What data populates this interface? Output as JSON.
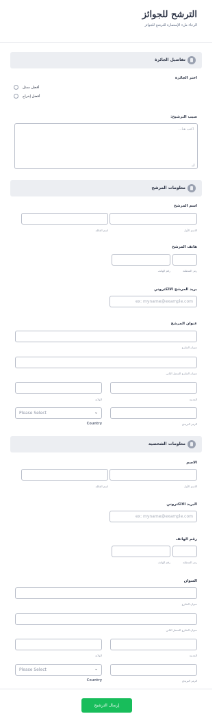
{
  "header": {
    "title": "الترشح للجوائز",
    "subtitle": "الرجاء ملء الإستمارة للترشح للجوائز"
  },
  "sections": {
    "award": "تفاصيل الجائزة",
    "nominee": "معلومات المرشح",
    "personal": "معلومات الشخصية"
  },
  "award": {
    "choose_label": "اختر الجائزة",
    "options": [
      "أفضل ممثل",
      "أفضل إخراج"
    ],
    "reason_label": "سبب الترشيح:",
    "reason_placeholder": "اكتب هنا..."
  },
  "nominee": {
    "name_label": "اسم المرشح",
    "first_sub": "الاسم الأول",
    "last_sub": "اسم العائلة",
    "phone_label": "هاتف المرشح",
    "area_sub": "رمز المنطقة",
    "number_sub": "رقم الهاتف",
    "email_label": "بريد المرشح الالكتروني",
    "email_placeholder": "ex: myname@example.com",
    "address_label": "عنوان المرشح",
    "street_sub": "عنوان الشارع",
    "street2_sub": "عنوان الشارع السطر الثاني",
    "city_sub": "المدينة",
    "state_sub": "الولاية",
    "zip_sub": "الرمز البريدي",
    "country_placeholder": "Please Select",
    "country_sub": "Country"
  },
  "personal": {
    "name_label": "الاسم",
    "first_sub": "الاسم الأول",
    "last_sub": "اسم العائلة",
    "email_label": "البريد الالكتروني",
    "email_placeholder": "ex: myname@example.com",
    "phone_label": "رقم الهاتف",
    "area_sub": "رمز المنطقة",
    "number_sub": "رقم الهاتف",
    "address_label": "العنوان",
    "street_sub": "عنوان الشارع",
    "street2_sub": "عنوان الشارع السطر الثاني",
    "city_sub": "المدينة",
    "state_sub": "الولاية",
    "zip_sub": "الرمز البريدي",
    "country_placeholder": "Please Select",
    "country_sub": "Country"
  },
  "submit_label": "إرسال الترشيح"
}
